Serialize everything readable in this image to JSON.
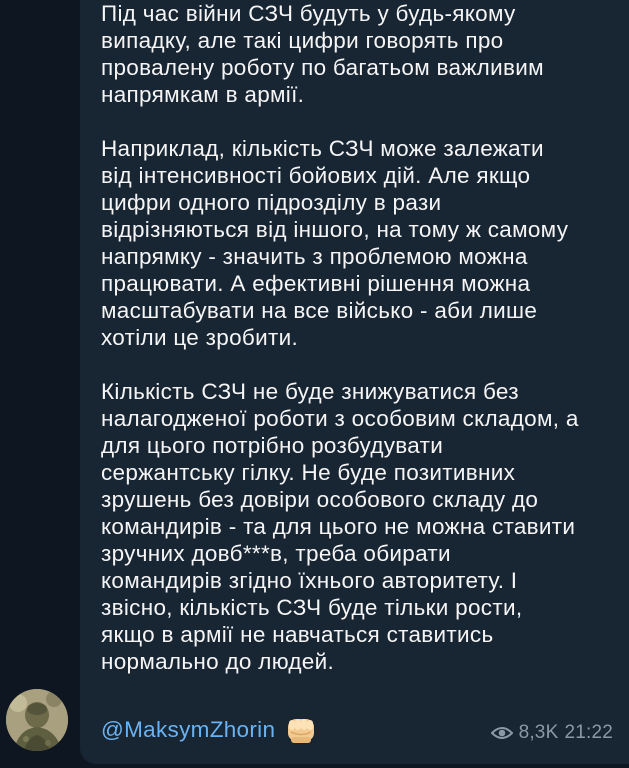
{
  "message": {
    "paragraphs": [
      "Під час війни СЗЧ будуть у будь-якому\nвипадку, але такі цифри говорять про\nпровалену роботу по багатьом важливим\nнапрямкам в армії.",
      "Наприклад, кількість СЗЧ може залежати\nвід інтенсивності бойових дій. Але якщо\nцифри одного підрозділу в рази\nвідрізняються від іншого, на тому ж самому\nнапрямку - значить з проблемою можна\nпрацювати. А ефективні рішення можна\nмасштабувати на все військо - аби лише\nхотіли це зробити.",
      "Кількість СЗЧ не буде знижуватися без\nналагодженої роботи з особовим складом, а\nдля цього потрібно розбудувати\nсержантську гілку. Не буде позитивних\nзрушень без довіри особового складу до\nкомандирів - та для цього не можна ставити\nзручних довб***в, треба обирати\nкомандирів згідно їхнього авторитету. І\nзвісно, кількість СЗЧ буде тільки рости,\nякщо в армії не навчаться ставитись\nнормально до людей."
    ],
    "signature": "@MaksymZhorin",
    "signature_emoji": "fist-icon",
    "views": "8,3K",
    "time": "21:22",
    "views_icon": "eye-icon"
  },
  "colors": {
    "background": "#0e1621",
    "bubble": "#182533",
    "text": "#f5f5f5",
    "link": "#6ab3f3",
    "meta": "#8b98a6"
  }
}
